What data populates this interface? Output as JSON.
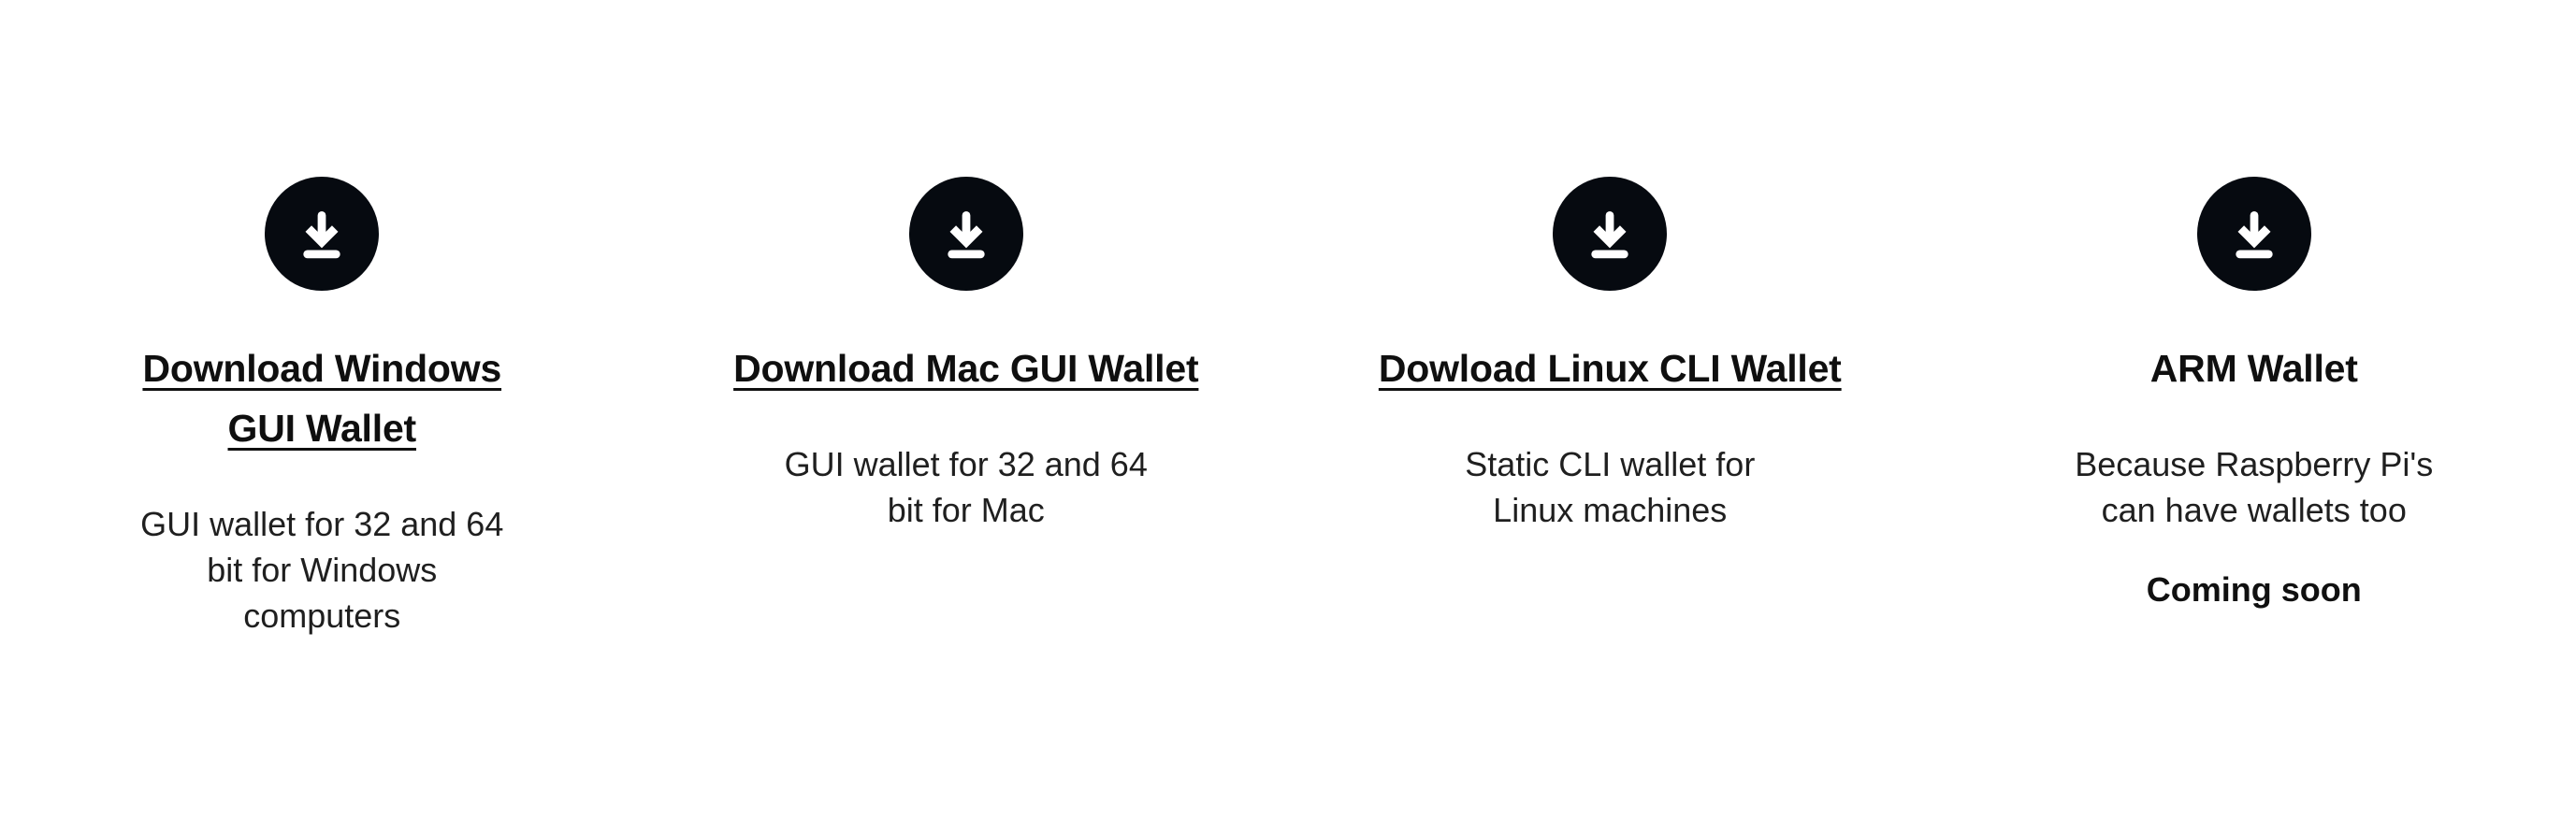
{
  "page": {
    "background_color": "#ffffff",
    "text_color": "#1a1a1a",
    "icon_color": "#060a10",
    "icon_glyph_color": "#ffffff"
  },
  "downloads": {
    "columns": [
      {
        "icon": "download-icon",
        "title": "Download Windows GUI Wallet",
        "is_link": true,
        "description": "GUI wallet for 32 and 64 bit for Windows computers",
        "note": ""
      },
      {
        "icon": "download-icon",
        "title": "Download Mac GUI Wallet",
        "is_link": true,
        "description": "GUI wallet for 32 and 64 bit for Mac",
        "note": ""
      },
      {
        "icon": "download-icon",
        "title": "Dowload Linux CLI Wallet",
        "is_link": true,
        "description": "Static CLI wallet for Linux machines",
        "note": ""
      },
      {
        "icon": "download-icon",
        "title": "ARM Wallet",
        "is_link": false,
        "description": "Because Raspberry Pi's can have wallets too",
        "note": "Coming soon"
      }
    ]
  }
}
